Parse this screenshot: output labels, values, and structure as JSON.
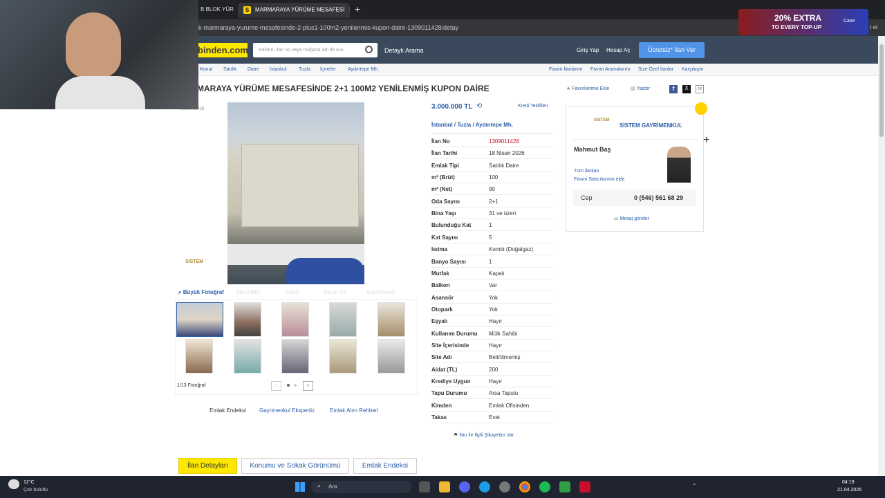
{
  "browser": {
    "tabs": [
      {
        "label": "B BLOK YÜR"
      },
      {
        "label": "MARMARAYA YÜRÜME MESAFESİ",
        "icon": "S"
      }
    ],
    "new_tab": "+",
    "url": "k-marmaraya-yurume-mesafesinde-2-plus1-100m2-yenilenmis-kupon-daire-1309011428/detay",
    "ad_text": "20% EXTRA",
    "ad_sub": "TO EVERY TOP-UP",
    "ad_brand": "Case",
    "side_text": "t et"
  },
  "site": {
    "logo": "binden.com",
    "search_placeholder": "Kelime, ilan no veya mağaza adı ile ara",
    "detailed_search": "Detaylı Arama",
    "login": "Giriş Yap",
    "register": "Hesap Aç",
    "post_ad": "Ücretsiz* İlan Ver"
  },
  "breadcrumb": [
    "Konut",
    "Satılık",
    "Daire",
    "İstanbul",
    "Tuzla",
    "İçmeler",
    "Aydıntepe Mh."
  ],
  "right_links": [
    "Favori İlanlarım",
    "Favori Aramalarım",
    "Size Özel İlanlar",
    "Karşılaştır"
  ],
  "listing": {
    "title": "MARAYA YÜRÜME MESAFESİNDE 2+1 100M2 YENİLENMİŞ KUPON DAİRE",
    "id_small": "#1309011428",
    "favorite": "Favorilerime Ekle",
    "print": "Yazdır",
    "price": "3.000.000 TL",
    "credit": "Kredi Teklifleri",
    "location": [
      "İstanbul",
      "/",
      "Tuzla",
      "/",
      "Aydıntepe Mh."
    ]
  },
  "media": {
    "big_photo": "Büyük Fotoğraf",
    "map": "İlan Kilde",
    "video": "Video",
    "virtual": "Sanal Tur",
    "sold": "Satılı/Dekor",
    "count": "1/13 Fotoğraf",
    "watermark": "SİSTEM"
  },
  "details": [
    [
      "İlan No",
      "1309011428"
    ],
    [
      "İlan Tarihi",
      "18 Nisan 2026"
    ],
    [
      "Emlak Tipi",
      "Satılık Daire"
    ],
    [
      "m² (Brüt)",
      "100"
    ],
    [
      "m² (Net)",
      "90"
    ],
    [
      "Oda Sayısı",
      "2+1"
    ],
    [
      "Bina Yaşı",
      "31 ve üzeri"
    ],
    [
      "Bulunduğu Kat",
      "1"
    ],
    [
      "Kat Sayısı",
      "5"
    ],
    [
      "Isıtma",
      "Kombi (Doğalgaz)"
    ],
    [
      "Banyo Sayısı",
      "1"
    ],
    [
      "Mutfak",
      "Kapalı"
    ],
    [
      "Balkon",
      "Var"
    ],
    [
      "Asansör",
      "Yok"
    ],
    [
      "Otopark",
      "Yok"
    ],
    [
      "Eşyalı",
      "Hayır"
    ],
    [
      "Kullanım Durumu",
      "Mülk Sahibi"
    ],
    [
      "Site İçerisinde",
      "Hayır"
    ],
    [
      "Site Adı",
      "Belirtilmemiş"
    ],
    [
      "Aidat (TL)",
      "200"
    ],
    [
      "Krediye Uygun",
      "Hayır"
    ],
    [
      "Tapu Durumu",
      "Arsa Tapulu"
    ],
    [
      "Kimden",
      "Emlak Ofisinden"
    ],
    [
      "Takas",
      "Evet"
    ]
  ],
  "complaint": "İlan ile İlgili Şikayetim Var",
  "under_links": [
    "Emlak Endeksi",
    "Gayrimenkul Ekspertiz",
    "Emlak Alım Rehberi"
  ],
  "seller": {
    "company": "SİSTEM GAYRİMENKUL",
    "name": "Mahmut Baş",
    "all_ads": "Tüm ilanları",
    "fav_seller": "Favori Satıcılarıma ekle",
    "phone_label": "Cep",
    "phone": "0 (546) 561 68 29",
    "message": "Mesaj gönder",
    "logo_text": "SİSTEM"
  },
  "bottom_tabs": [
    "İlan Detayları",
    "Konumu ve Sokak Görünümü",
    "Emlak Endeksi"
  ],
  "taskbar": {
    "temp": "12°C",
    "weather": "Çok bulutlu",
    "search": "Ara",
    "time": "04:19",
    "date": "21.04.2026"
  },
  "colors": {
    "yellow": "#ffe800",
    "header": "#3a4a5c",
    "link": "#2b5da8",
    "accent_red": "#c8102e"
  }
}
